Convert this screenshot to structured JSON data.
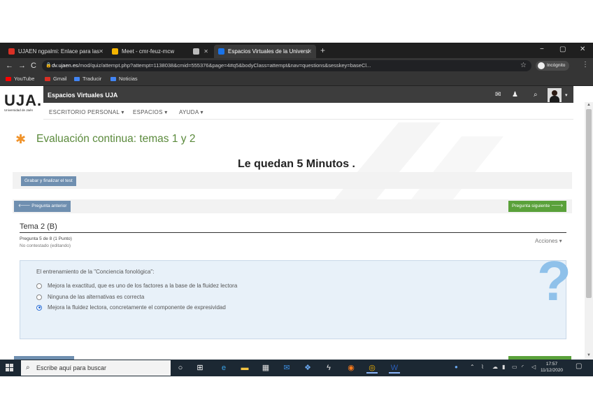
{
  "browser": {
    "tabs": [
      {
        "label": "UJAEN ngpalmi: Enlace para las",
        "icon": "gmail-icon",
        "color": "#d93025"
      },
      {
        "label": "Meet - cmr-feuz-mcw",
        "icon": "meet-icon",
        "color": "#f4b400"
      },
      {
        "label": "",
        "icon": "extension-icon",
        "color": "#bbbbbb"
      },
      {
        "label": "Espacios Virtuales de la Universi",
        "icon": "moodle-icon",
        "color": "#1a73e8",
        "active": true
      }
    ],
    "new_tab_glyph": "+",
    "window_controls": [
      "−",
      "▢",
      "✕"
    ],
    "url": "dv.ujaen.es/mod/quiz/attempt.php?attempt=1138038&cmid=555376&page=4#q5&bodyClass=attempt&nav=questions&sesskey=baseCl...",
    "url_prefix": "dv.ujaen.es",
    "url_rest": "/mod/quiz/attempt.php?attempt=1138038&cmid=555376&page=4#q5&bodyClass=attempt&nav=questions&sesskey=baseCl...",
    "profile_label": "Incógnito",
    "bookmarks": [
      {
        "label": "YouTube",
        "icon": "youtube-icon",
        "color": "#ff0000"
      },
      {
        "label": "Gmail",
        "icon": "gmail-icon",
        "color": "#d93025"
      },
      {
        "label": "Traducir",
        "icon": "translate-icon",
        "color": "#4285f4"
      },
      {
        "label": "Noticias",
        "icon": "news-icon",
        "color": "#4285f4"
      }
    ]
  },
  "site": {
    "logo": "UJA.",
    "logo_sub": "Universidad de Jaén",
    "name": "Espacios Virtuales UJA",
    "menu": [
      "ESCRITORIO PERSONAL ▾",
      "ESPACIOS ▾",
      "AYUDA ▾"
    ]
  },
  "quiz": {
    "title": "Evaluación continua: temas 1 y 2",
    "timer": "Le quedan 5 Minutos .",
    "finish_button": "Grabar y finalizar el test",
    "prev_button": "Pregunta anterior",
    "next_button": "Pregunta siguiente",
    "section_title": "Tema 2 (B)",
    "question_number": "Pregunta 5 de 8 (1 Punto)",
    "question_status": "No contestado (editando)",
    "actions_label": "Acciones ▾",
    "question_text": "El entrenamiento de la \"Conciencia fonológica\":",
    "options": [
      {
        "label": "Mejora la exactitud, que es uno de los factores a la base de la fluidez lectora",
        "selected": false
      },
      {
        "label": "Ninguna de las alternativas es correcta",
        "selected": false
      },
      {
        "label": "Mejora la fluidez lectora, concretamente el componente de expresividad",
        "selected": true
      }
    ],
    "help_glyph": "?"
  },
  "taskbar": {
    "search_placeholder": "Escribe aquí para buscar",
    "time": "17:57",
    "date": "11/12/2020"
  }
}
